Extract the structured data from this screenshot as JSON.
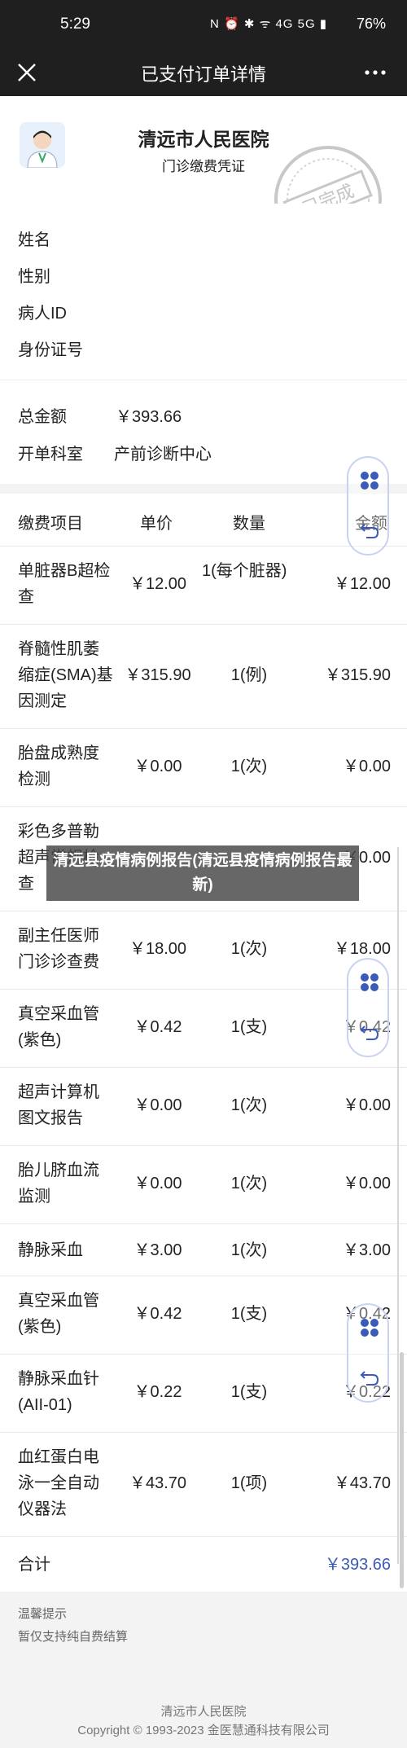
{
  "status_bar": {
    "time": "5:29",
    "icons_text": "N ⏰ ✱ ᯤ 4G 5G ▮",
    "battery": "76%"
  },
  "nav": {
    "title": "已支付订单详情"
  },
  "header": {
    "hospital": "清远市人民医院",
    "subtitle": "门诊缴费凭证",
    "stamp": "已完成"
  },
  "patient": [
    {
      "label": "姓名",
      "value": ""
    },
    {
      "label": "性别",
      "value": ""
    },
    {
      "label": "病人ID",
      "value": ""
    },
    {
      "label": "身份证号",
      "value": ""
    }
  ],
  "summary": [
    {
      "label": "总金额",
      "value": "￥393.66"
    },
    {
      "label": "开单科室",
      "value": "产前诊断中心"
    }
  ],
  "table": {
    "headers": [
      "缴费项目",
      "单价",
      "数量",
      "金额"
    ],
    "rows": [
      {
        "name": "单脏器B超检查",
        "price": "￥12.00",
        "qty": "1(每个脏器)",
        "amount": "￥12.00"
      },
      {
        "name": "脊髓性肌萎缩症(SMA)基因测定",
        "price": "￥315.90",
        "qty": "1(例)",
        "amount": "￥315.90"
      },
      {
        "name": "胎盘成熟度检测",
        "price": "￥0.00",
        "qty": "1(次)",
        "amount": "￥0.00"
      },
      {
        "name": "彩色多普勒超声常规检查",
        "price": "",
        "qty": "",
        "amount": "￥0.00"
      },
      {
        "name": "副主任医师门诊诊查费",
        "price": "￥18.00",
        "qty": "1(次)",
        "amount": "￥18.00"
      },
      {
        "name": "真空采血管(紫色)",
        "price": "￥0.42",
        "qty": "1(支)",
        "amount": "￥0.42"
      },
      {
        "name": "超声计算机图文报告",
        "price": "￥0.00",
        "qty": "1(次)",
        "amount": "￥0.00"
      },
      {
        "name": "胎儿脐血流监测",
        "price": "￥0.00",
        "qty": "1(次)",
        "amount": "￥0.00"
      },
      {
        "name": "静脉采血",
        "price": "￥3.00",
        "qty": "1(次)",
        "amount": "￥3.00"
      },
      {
        "name": "真空采血管(紫色)",
        "price": "￥0.42",
        "qty": "1(支)",
        "amount": "￥0.42"
      },
      {
        "name": "静脉采血针(AII-01)",
        "price": "￥0.22",
        "qty": "1(支)",
        "amount": "￥0.22"
      },
      {
        "name": "血红蛋白电泳一全自动仪器法",
        "price": "￥43.70",
        "qty": "1(项)",
        "amount": "￥43.70"
      }
    ],
    "total_label": "合计",
    "total_value": "￥393.66"
  },
  "overlay_text": "清远县疫情病例报告(清远县疫情病例报告最新)",
  "tips": {
    "title": "温馨提示",
    "body": "暂仅支持纯自费结算"
  },
  "footer": {
    "line1": "清远市人民医院",
    "line2": "Copyright © 1993-2023 金医慧通科技有限公司"
  },
  "colors": {
    "total": "#3a5bb8",
    "dark_bar": "#1f1f1f",
    "float_border": "#c9d3ef"
  }
}
